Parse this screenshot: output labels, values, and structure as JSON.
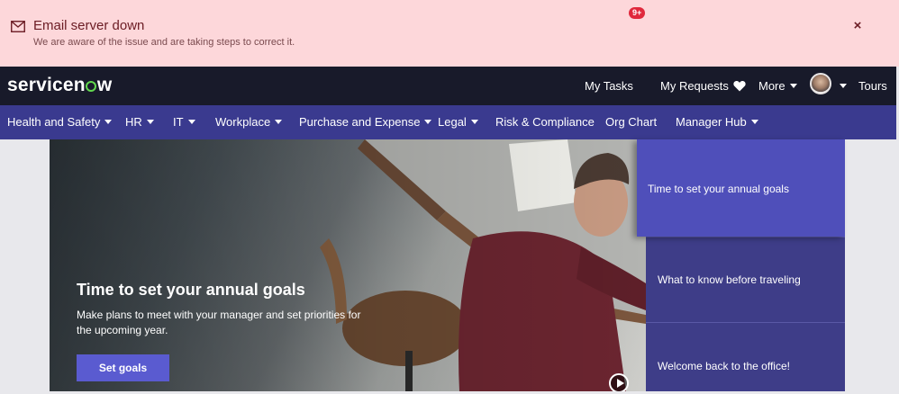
{
  "alert": {
    "title": "Email server down",
    "message": "We are aware of the issue and are taking steps to correct it.",
    "icon": "mail-icon",
    "close_label": "×",
    "background": "#fdd7da"
  },
  "header": {
    "logo_prefix": "servicen",
    "logo_suffix": "w",
    "my_tasks": "My Tasks",
    "tasks_badge": "9+",
    "my_requests": "My Requests",
    "favorites_icon": "heart-icon",
    "more": "More",
    "tours": "Tours",
    "background": "#181a2a"
  },
  "nav": {
    "items": [
      {
        "label": "Health and Safety"
      },
      {
        "label": "HR"
      },
      {
        "label": "IT"
      },
      {
        "label": "Workplace"
      },
      {
        "label": "Purchase and Expense"
      },
      {
        "label": "Legal"
      },
      {
        "label": "Risk & Compliance"
      },
      {
        "label": "Org Chart"
      },
      {
        "label": "Manager Hub"
      }
    ],
    "background": "#3a3a8f"
  },
  "hero": {
    "title": "Time to set your annual goals",
    "description": "Make plans to meet with your manager and set priorities for the upcoming year.",
    "button": "Set goals",
    "button_color": "#5a5bd0"
  },
  "cards": [
    {
      "label": "Time to set your annual goals"
    },
    {
      "label": "What to know before traveling"
    },
    {
      "label": "Welcome back to the office!"
    }
  ]
}
